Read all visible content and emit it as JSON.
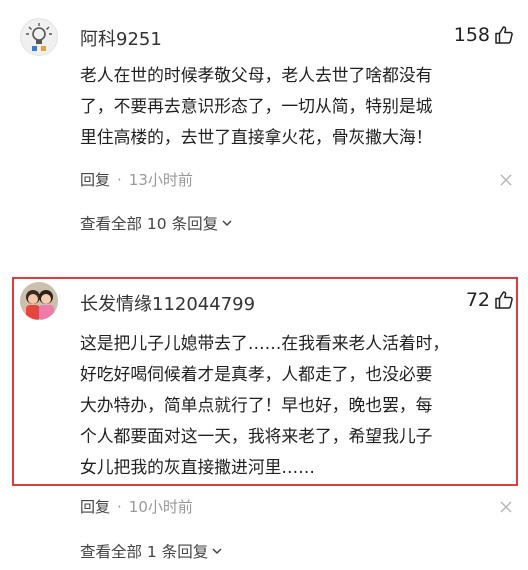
{
  "comments": [
    {
      "username": "阿科9251",
      "likes": "158",
      "lines": [
        "老人在世的时候孝敬父母，老人去世了啥都没有",
        "了，不要再去意识形态了，一切从简，特别是城",
        "里住高楼的，去世了直接拿火花，骨灰撒大海！"
      ],
      "reply_label": "回复",
      "separator": "·",
      "time": "13小时前",
      "view_all": "查看全部 10 条回复"
    },
    {
      "username": "长发情缘112044799",
      "likes": "72",
      "lines": [
        "这是把儿子儿媳带去了……在我看来老人活着时，",
        "好吃好喝伺候着才是真孝，人都走了，也没必要",
        "大办特办，简单点就行了！早也好，晚也罢，每",
        "个人都要面对这一天，我将来老了，希望我儿子",
        "女儿把我的灰直接撒进河里……"
      ],
      "reply_label": "回复",
      "separator": "·",
      "time": "10小时前",
      "view_all": "查看全部 1 条回复"
    }
  ],
  "icons": {
    "like": "thumbs-up-icon",
    "close": "close-icon",
    "expand": "chevron-down-icon"
  },
  "colors": {
    "highlight_border": "#e23b3b",
    "text": "#222222",
    "meta": "#999999"
  }
}
